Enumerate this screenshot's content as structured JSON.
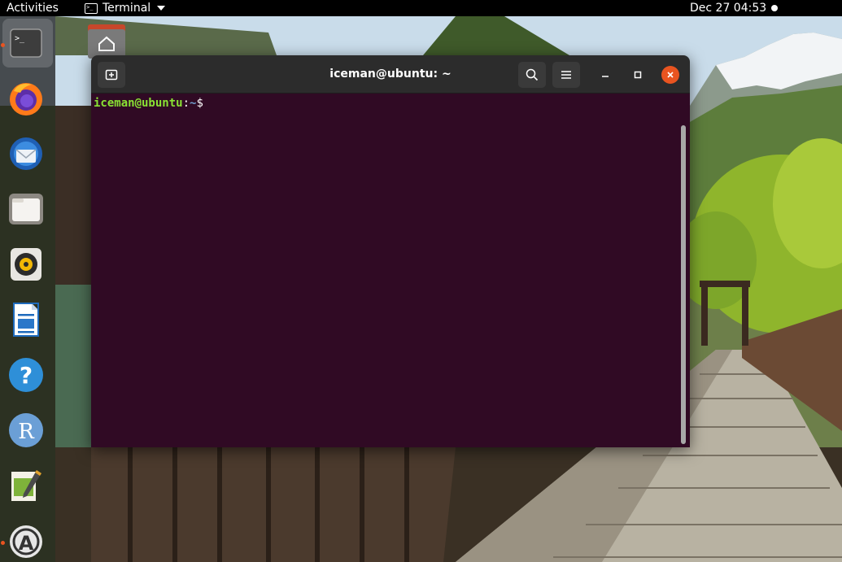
{
  "topbar": {
    "activities_label": "Activities",
    "app_name": "Terminal",
    "app_icon": "terminal-icon",
    "clock": "Dec 27  04:53"
  },
  "dock": {
    "items": [
      {
        "name": "Terminal",
        "icon": "terminal-icon",
        "running": true,
        "active": true
      },
      {
        "name": "Firefox",
        "icon": "firefox-icon",
        "running": false,
        "active": false
      },
      {
        "name": "Thunderbird",
        "icon": "thunderbird-icon",
        "running": false,
        "active": false
      },
      {
        "name": "Files",
        "icon": "files-icon",
        "running": false,
        "active": false
      },
      {
        "name": "Rhythmbox",
        "icon": "rhythmbox-icon",
        "running": false,
        "active": false
      },
      {
        "name": "LibreOffice Writer",
        "icon": "libreoffice-writer-icon",
        "running": false,
        "active": false
      },
      {
        "name": "Help",
        "icon": "help-icon",
        "running": false,
        "active": false
      },
      {
        "name": "RStudio",
        "icon": "r-icon",
        "running": false,
        "active": false
      },
      {
        "name": "Text Editor",
        "icon": "text-editor-icon",
        "running": false,
        "active": false
      },
      {
        "name": "Software Updater",
        "icon": "software-updater-icon",
        "running": true,
        "active": false
      }
    ]
  },
  "terminal": {
    "title": "iceman@ubuntu: ~",
    "prompt_user": "iceman@ubuntu",
    "prompt_sep": ":",
    "prompt_path": "~",
    "prompt_symbol": "$",
    "buttons": [
      "new-tab-icon",
      "search-icon",
      "hamburger-menu-icon",
      "minimize-icon",
      "maximize-icon",
      "close-icon"
    ]
  },
  "colors": {
    "terminal_bg": "#300a24",
    "titlebar_bg": "#2c2c2c",
    "prompt_user": "#8ae234",
    "prompt_path": "#729fcf",
    "close_button": "#e95420",
    "running_indicator": "#e95420"
  }
}
